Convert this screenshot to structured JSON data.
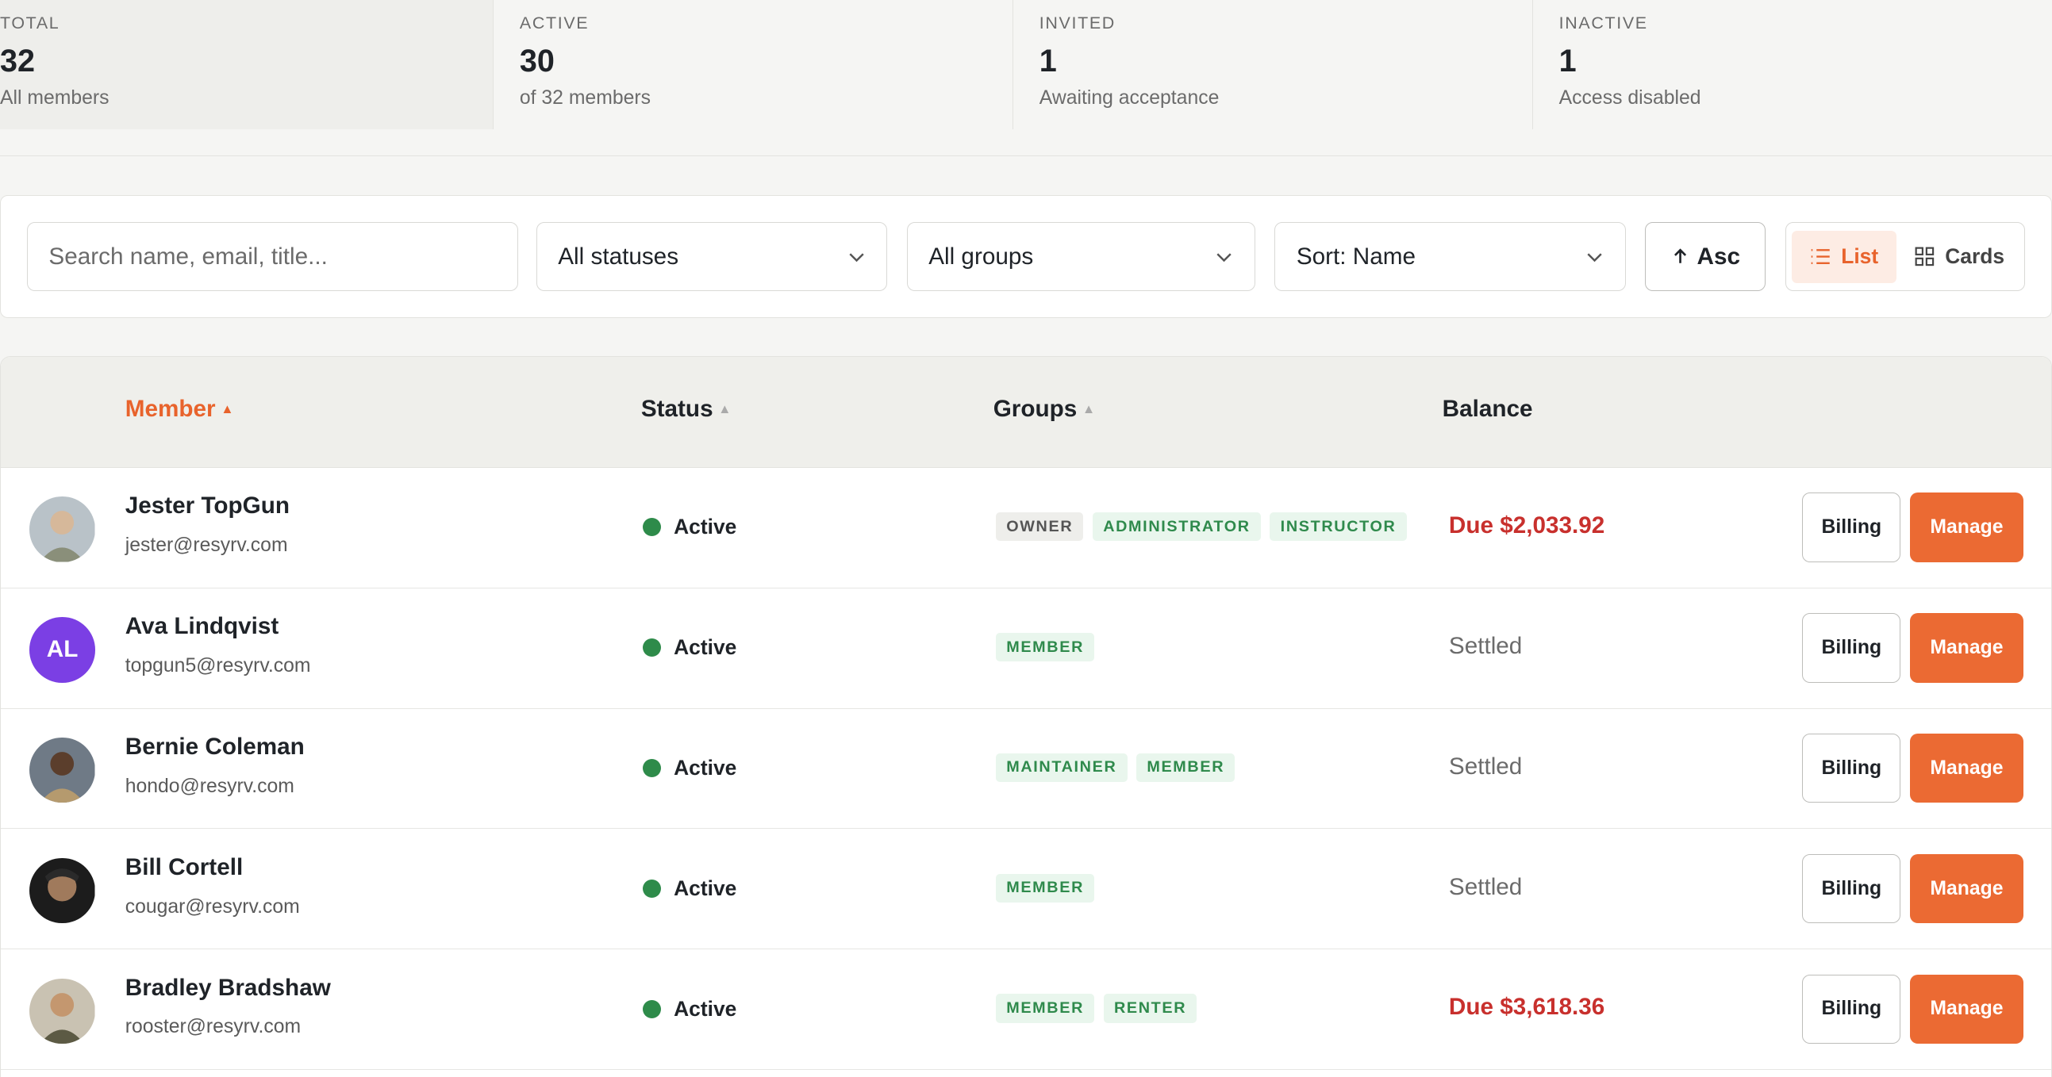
{
  "stats": [
    {
      "label": "TOTAL",
      "value": "32",
      "sub": "All members"
    },
    {
      "label": "ACTIVE",
      "value": "30",
      "sub": "of 32 members"
    },
    {
      "label": "INVITED",
      "value": "1",
      "sub": "Awaiting acceptance"
    },
    {
      "label": "INACTIVE",
      "value": "1",
      "sub": "Access disabled"
    }
  ],
  "toolbar": {
    "search_placeholder": "Search name, email, title...",
    "status_filter": "All statuses",
    "group_filter": "All groups",
    "sort": "Sort: Name",
    "order": "Asc",
    "view_list": "List",
    "view_cards": "Cards",
    "active_view": "List"
  },
  "columns": {
    "member": "Member",
    "status": "Status",
    "groups": "Groups",
    "balance": "Balance"
  },
  "members": [
    {
      "name": "Jester TopGun",
      "email": "jester@resyrv.com",
      "status": "Active",
      "groups": [
        "OWNER",
        "ADMINISTRATOR",
        "INSTRUCTOR"
      ],
      "balance": "Due $2,033.92",
      "avatar": "photo"
    },
    {
      "name": "Ava Lindqvist",
      "email": "topgun5@resyrv.com",
      "status": "Active",
      "groups": [
        "MEMBER"
      ],
      "balance": "Settled",
      "avatar": "initials",
      "initials": "AL"
    },
    {
      "name": "Bernie Coleman",
      "email": "hondo@resyrv.com",
      "status": "Active",
      "groups": [
        "MAINTAINER",
        "MEMBER"
      ],
      "balance": "Settled",
      "avatar": "photo"
    },
    {
      "name": "Bill Cortell",
      "email": "cougar@resyrv.com",
      "status": "Active",
      "groups": [
        "MEMBER"
      ],
      "balance": "Settled",
      "avatar": "photo"
    },
    {
      "name": "Bradley Bradshaw",
      "email": "rooster@resyrv.com",
      "status": "Active",
      "groups": [
        "MEMBER",
        "RENTER"
      ],
      "balance": "Due $3,618.36",
      "avatar": "photo"
    }
  ],
  "actions": {
    "billing": "Billing",
    "manage": "Manage"
  },
  "colors": {
    "accent": "#eb6a33",
    "due": "#c8302d",
    "active_dot": "#2e8b4a",
    "avatar_al": "#7b3fe4"
  }
}
